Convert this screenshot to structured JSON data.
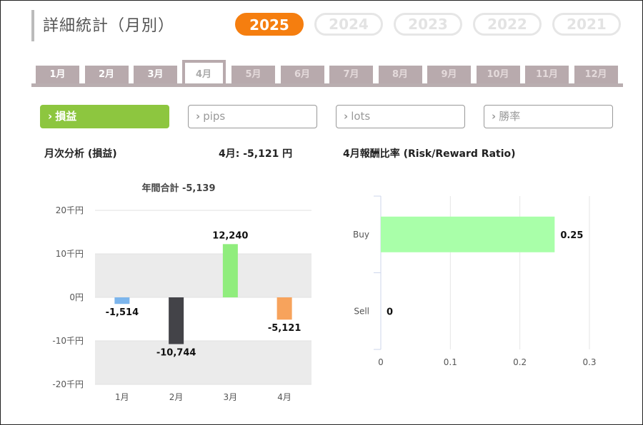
{
  "header": {
    "title": "詳細統計（月別）"
  },
  "years": [
    {
      "label": "2025",
      "active": true
    },
    {
      "label": "2024",
      "active": false
    },
    {
      "label": "2023",
      "active": false
    },
    {
      "label": "2022",
      "active": false
    },
    {
      "label": "2021",
      "active": false
    }
  ],
  "months": [
    {
      "label": "1月",
      "state": "normal"
    },
    {
      "label": "2月",
      "state": "normal"
    },
    {
      "label": "3月",
      "state": "normal"
    },
    {
      "label": "4月",
      "state": "active"
    },
    {
      "label": "5月",
      "state": "dim"
    },
    {
      "label": "6月",
      "state": "dim"
    },
    {
      "label": "7月",
      "state": "dim"
    },
    {
      "label": "8月",
      "state": "dim"
    },
    {
      "label": "9月",
      "state": "dim"
    },
    {
      "label": "10月",
      "state": "dim"
    },
    {
      "label": "11月",
      "state": "dim"
    },
    {
      "label": "12月",
      "state": "dim"
    }
  ],
  "metrics": [
    {
      "label": "損益",
      "active": true
    },
    {
      "label": "pips",
      "active": false
    },
    {
      "label": "lots",
      "active": false
    },
    {
      "label": "勝率",
      "active": false
    }
  ],
  "chevron_glyph": "›",
  "section": {
    "monthly_title": "月次分析 (損益)",
    "month_summary": "4月:  -5,121 円",
    "ratio_title": "4月報酬比率 (Risk/Reward Ratio)"
  },
  "colors": {
    "accent_orange": "#f57e0f",
    "metric_green": "#8dc63f",
    "tab_gray": "#b8aaad"
  },
  "chart_data": [
    {
      "type": "bar",
      "title": "年間合計 -5,139",
      "categories": [
        "1月",
        "2月",
        "3月",
        "4月"
      ],
      "values": [
        -1514,
        -10744,
        12240,
        -5121
      ],
      "value_labels": [
        "-1,514",
        "-10,744",
        "12,240",
        "-5,121"
      ],
      "colors": [
        "#7cb5ec",
        "#434348",
        "#90ed7d",
        "#f7a35c"
      ],
      "ylim": [
        -20000,
        20000
      ],
      "yticks": [
        20000,
        10000,
        0,
        -10000,
        -20000
      ],
      "ytick_labels": [
        "20千円",
        "10千円",
        "0円",
        "-10千円",
        "-20千円"
      ],
      "alternate_band_fill": "#ebebeb"
    },
    {
      "type": "bar",
      "orientation": "horizontal",
      "categories": [
        "Buy",
        "Sell"
      ],
      "values": [
        0.25,
        0
      ],
      "value_labels": [
        "0.25",
        "0"
      ],
      "colors": [
        "#a9ffa9",
        "#a9ffa9"
      ],
      "xlim": [
        0,
        0.3
      ],
      "xticks": [
        0,
        0.1,
        0.2,
        0.3
      ],
      "xtick_labels": [
        "0",
        "0.1",
        "0.2",
        "0.3"
      ],
      "grid": true
    }
  ]
}
